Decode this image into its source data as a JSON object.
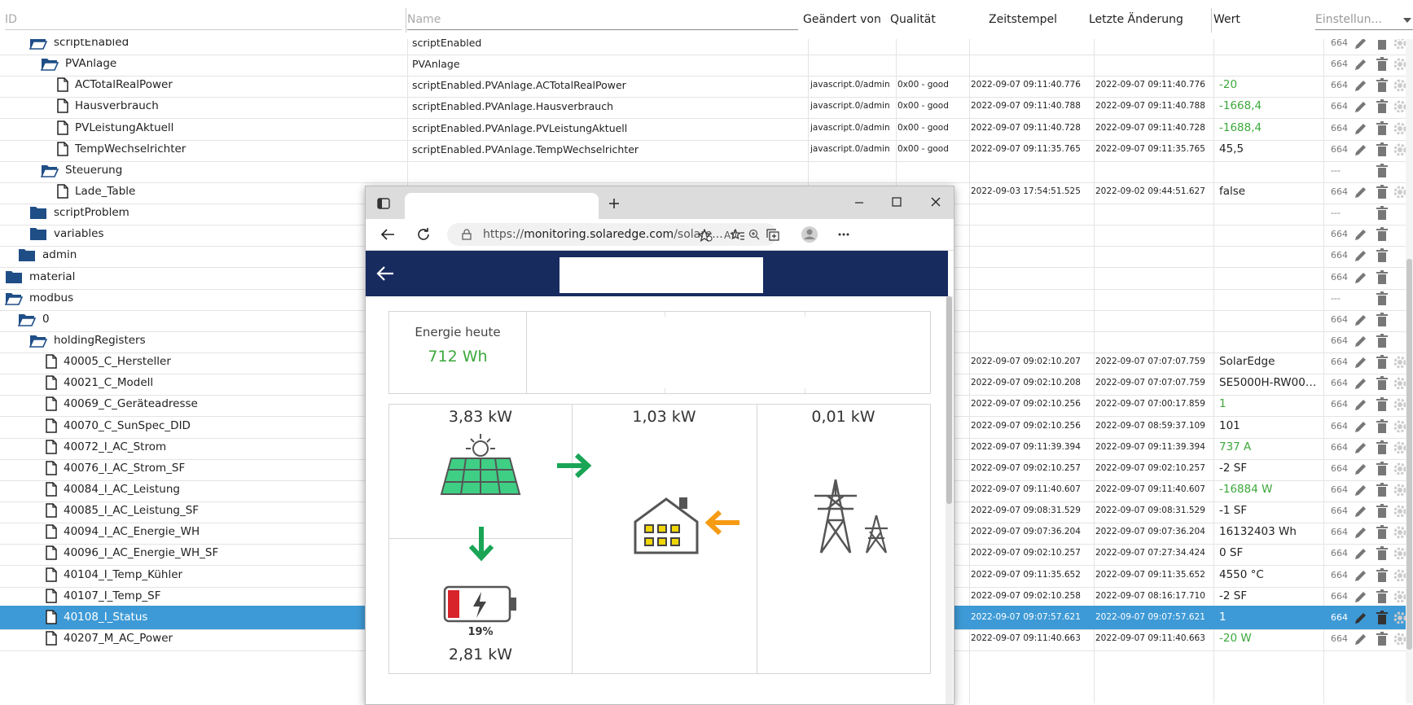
{
  "header": {
    "id_placeholder": "ID",
    "name_placeholder": "Name",
    "columns": [
      "Geändert von",
      "Qualität",
      "Zeitstempel",
      "Letzte Änderung",
      "Wert"
    ],
    "settings_label": "Einstellun..."
  },
  "rows": [
    {
      "label": "scriptEnabled",
      "type": "folder-open",
      "indent": 36,
      "name": "scriptEnabled",
      "from": "",
      "quality": "",
      "ts": "",
      "lc": "",
      "value": "",
      "acl": "664",
      "actions": "full"
    },
    {
      "label": "PVAnlage",
      "type": "folder-open",
      "indent": 50,
      "name": "PVAnlage",
      "from": "",
      "quality": "",
      "ts": "",
      "lc": "",
      "value": "",
      "acl": "664",
      "actions": "full"
    },
    {
      "label": "ACTotalRealPower",
      "type": "file",
      "indent": 70,
      "name": "scriptEnabled.PVAnlage.ACTotalRealPower",
      "from": "javascript.0/admin",
      "quality": "0x00 - good",
      "ts": "2022-09-07 09:11:40.776",
      "lc": "2022-09-07 09:11:40.776",
      "value": "-20",
      "green": true,
      "acl": "664",
      "actions": "full"
    },
    {
      "label": "Hausverbrauch",
      "type": "file",
      "indent": 70,
      "name": "scriptEnabled.PVAnlage.Hausverbrauch",
      "from": "javascript.0/admin",
      "quality": "0x00 - good",
      "ts": "2022-09-07 09:11:40.788",
      "lc": "2022-09-07 09:11:40.788",
      "value": "-1668,4",
      "green": true,
      "acl": "664",
      "actions": "full"
    },
    {
      "label": "PVLeistungAktuell",
      "type": "file",
      "indent": 70,
      "name": "scriptEnabled.PVAnlage.PVLeistungAktuell",
      "from": "javascript.0/admin",
      "quality": "0x00 - good",
      "ts": "2022-09-07 09:11:40.728",
      "lc": "2022-09-07 09:11:40.728",
      "value": "-1688,4",
      "green": true,
      "acl": "664",
      "actions": "full"
    },
    {
      "label": "TempWechselrichter",
      "type": "file",
      "indent": 70,
      "name": "scriptEnabled.PVAnlage.TempWechselrichter",
      "from": "javascript.0/admin",
      "quality": "0x00 - good",
      "ts": "2022-09-07 09:11:35.765",
      "lc": "2022-09-07 09:11:35.765",
      "value": "45,5",
      "acl": "664",
      "actions": "full"
    },
    {
      "label": "Steuerung",
      "type": "folder-open",
      "indent": 50,
      "name": "",
      "from": "",
      "quality": "",
      "ts": "",
      "lc": "",
      "value": "",
      "acl": "---",
      "actions": "del"
    },
    {
      "label": "Lade_Table",
      "type": "file",
      "indent": 70,
      "name": "",
      "from": "",
      "quality": "",
      "ts": "2022-09-03 17:54:51.525",
      "lc": "2022-09-02 09:44:51.627",
      "value": "false",
      "acl": "664",
      "actions": "full"
    },
    {
      "label": "scriptProblem",
      "type": "folder",
      "indent": 36,
      "name": "",
      "from": "",
      "quality": "",
      "ts": "",
      "lc": "",
      "value": "",
      "acl": "---",
      "actions": "del"
    },
    {
      "label": "variables",
      "type": "folder",
      "indent": 36,
      "name": "",
      "from": "",
      "quality": "",
      "ts": "",
      "lc": "",
      "value": "",
      "acl": "664",
      "actions": "edit"
    },
    {
      "label": "admin",
      "type": "folder",
      "indent": 22,
      "name": "",
      "from": "",
      "quality": "",
      "ts": "",
      "lc": "",
      "value": "",
      "acl": "664",
      "actions": "edit"
    },
    {
      "label": "material",
      "type": "folder",
      "indent": 6,
      "name": "",
      "from": "",
      "quality": "",
      "ts": "",
      "lc": "",
      "value": "",
      "acl": "664",
      "actions": "edit"
    },
    {
      "label": "modbus",
      "type": "folder-open",
      "indent": 6,
      "name": "",
      "from": "",
      "quality": "",
      "ts": "",
      "lc": "",
      "value": "",
      "acl": "---",
      "actions": "del"
    },
    {
      "label": "0",
      "type": "folder-open",
      "indent": 22,
      "name": "",
      "from": "",
      "quality": "",
      "ts": "",
      "lc": "",
      "value": "",
      "acl": "664",
      "actions": "edit"
    },
    {
      "label": "holdingRegisters",
      "type": "folder-open",
      "indent": 36,
      "name": "",
      "from": "",
      "quality": "",
      "ts": "",
      "lc": "",
      "value": "",
      "acl": "664",
      "actions": "edit"
    },
    {
      "label": "40005_C_Hersteller",
      "type": "file",
      "indent": 56,
      "name": "",
      "from": "",
      "quality": "",
      "ts": "2022-09-07 09:02:10.207",
      "lc": "2022-09-07 07:07:07.759",
      "value": "SolarEdge",
      "acl": "664",
      "actions": "full"
    },
    {
      "label": "40021_C_Modell",
      "type": "file",
      "indent": 56,
      "name": "",
      "from": "",
      "quality": "",
      "ts": "2022-09-07 09:02:10.208",
      "lc": "2022-09-07 07:07:07.759",
      "value": "SE5000H-RW000...",
      "acl": "664",
      "actions": "full"
    },
    {
      "label": "40069_C_Geräteadresse",
      "type": "file",
      "indent": 56,
      "name": "",
      "from": "",
      "quality": "",
      "ts": "2022-09-07 09:02:10.256",
      "lc": "2022-09-07 07:00:17.859",
      "value": "1",
      "green": true,
      "acl": "664",
      "actions": "full"
    },
    {
      "label": "40070_C_SunSpec_DID",
      "type": "file",
      "indent": 56,
      "name": "",
      "from": "",
      "quality": "",
      "ts": "2022-09-07 09:02:10.256",
      "lc": "2022-09-07 08:59:37.109",
      "value": "101",
      "acl": "664",
      "actions": "full"
    },
    {
      "label": "40072_I_AC_Strom",
      "type": "file",
      "indent": 56,
      "name": "",
      "from": "",
      "quality": "",
      "ts": "2022-09-07 09:11:39.394",
      "lc": "2022-09-07 09:11:39.394",
      "value": "737 A",
      "green": true,
      "acl": "664",
      "actions": "full"
    },
    {
      "label": "40076_I_AC_Strom_SF",
      "type": "file",
      "indent": 56,
      "name": "",
      "from": "",
      "quality": "",
      "ts": "2022-09-07 09:02:10.257",
      "lc": "2022-09-07 09:02:10.257",
      "value": "-2 SF",
      "acl": "664",
      "actions": "full"
    },
    {
      "label": "40084_I_AC_Leistung",
      "type": "file",
      "indent": 56,
      "name": "",
      "from": "",
      "quality": "",
      "ts": "2022-09-07 09:11:40.607",
      "lc": "2022-09-07 09:11:40.607",
      "value": "-16884 W",
      "green": true,
      "acl": "664",
      "actions": "full"
    },
    {
      "label": "40085_I_AC_Leistung_SF",
      "type": "file",
      "indent": 56,
      "name": "",
      "from": "",
      "quality": "",
      "ts": "2022-09-07 09:08:31.529",
      "lc": "2022-09-07 09:08:31.529",
      "value": "-1 SF",
      "acl": "664",
      "actions": "full"
    },
    {
      "label": "40094_I_AC_Energie_WH",
      "type": "file",
      "indent": 56,
      "name": "",
      "from": "",
      "quality": "",
      "ts": "2022-09-07 09:07:36.204",
      "lc": "2022-09-07 09:07:36.204",
      "value": "16132403 Wh",
      "acl": "664",
      "actions": "full"
    },
    {
      "label": "40096_I_AC_Energie_WH_SF",
      "type": "file",
      "indent": 56,
      "name": "",
      "from": "",
      "quality": "",
      "ts": "2022-09-07 09:02:10.257",
      "lc": "2022-09-07 07:27:34.424",
      "value": "0 SF",
      "acl": "664",
      "actions": "full"
    },
    {
      "label": "40104_I_Temp_Kühler",
      "type": "file",
      "indent": 56,
      "name": "",
      "from": "",
      "quality": "",
      "ts": "2022-09-07 09:11:35.652",
      "lc": "2022-09-07 09:11:35.652",
      "value": "4550 °C",
      "acl": "664",
      "actions": "full"
    },
    {
      "label": "40107_I_Temp_SF",
      "type": "file",
      "indent": 56,
      "name": "",
      "from": "",
      "quality": "",
      "ts": "2022-09-07 09:02:10.258",
      "lc": "2022-09-07 08:16:17.710",
      "value": "-2 SF",
      "acl": "664",
      "actions": "full"
    },
    {
      "label": "40108_I_Status",
      "type": "file",
      "indent": 56,
      "name": "",
      "from": "",
      "quality": "",
      "ts": "2022-09-07 09:07:57.621",
      "lc": "2022-09-07 09:07:57.621",
      "value": "1",
      "selected": true,
      "acl": "664",
      "actions": "full"
    },
    {
      "label": "40207_M_AC_Power",
      "type": "file",
      "indent": 56,
      "name": "",
      "from": "",
      "quality": "",
      "ts": "2022-09-07 09:11:40.663",
      "lc": "2022-09-07 09:11:40.663",
      "value": "-20 W",
      "green": true,
      "acl": "664",
      "actions": "full"
    }
  ],
  "browser": {
    "url_prefix": "https://",
    "url_host": "monitoring.solaredge.com",
    "url_rest": "/solare..."
  },
  "dashboard": {
    "energy_label": "Energie heute",
    "energy_value": "712 Wh",
    "pv_power": "3,83 kW",
    "house_power": "1,03 kW",
    "grid_power": "0,01 kW",
    "battery_pct": "19%",
    "battery_level": 0.19,
    "battery_power": "2,81 kW"
  },
  "colors": {
    "selected_row": "#3e9ad6",
    "green_value": "#3ca83c",
    "folder": "#1f4e86",
    "site_header": "#172b5f",
    "flow_green": "#1aa556",
    "flow_orange": "#f59b14",
    "battery_red": "#d8232a"
  }
}
